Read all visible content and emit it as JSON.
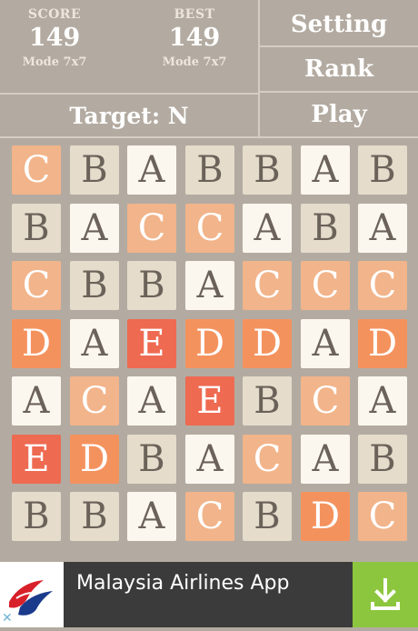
{
  "header": {
    "score": {
      "label": "SCORE",
      "value": "149",
      "mode": "Mode 7x7"
    },
    "best": {
      "label": "BEST",
      "value": "149",
      "mode": "Mode 7x7"
    },
    "target_label": "Target: N",
    "menu": {
      "setting": "Setting",
      "rank": "Rank",
      "play": "Play"
    }
  },
  "board": {
    "rows": [
      [
        "C",
        "B",
        "A",
        "B",
        "B",
        "A",
        "B"
      ],
      [
        "B",
        "A",
        "C",
        "C",
        "A",
        "B",
        "A"
      ],
      [
        "C",
        "B",
        "B",
        "A",
        "C",
        "C",
        "C"
      ],
      [
        "D",
        "A",
        "E",
        "D",
        "D",
        "A",
        "D"
      ],
      [
        "A",
        "C",
        "A",
        "E",
        "B",
        "C",
        "A"
      ],
      [
        "E",
        "D",
        "B",
        "A",
        "C",
        "A",
        "B"
      ],
      [
        "B",
        "B",
        "A",
        "C",
        "B",
        "D",
        "C"
      ]
    ]
  },
  "ad": {
    "text": "Malaysia Airlines App",
    "icons": {
      "logo": "malaysia-airlines-logo",
      "download": "download-icon",
      "close": "close-icon"
    }
  },
  "colors": {
    "background": "#b3aba1",
    "tile_A": "#fbf7ef",
    "tile_B": "#e6dccb",
    "tile_C": "#f2b48a",
    "tile_D": "#f4925e",
    "tile_E": "#ee6a51",
    "download_green": "#8cc63e"
  }
}
